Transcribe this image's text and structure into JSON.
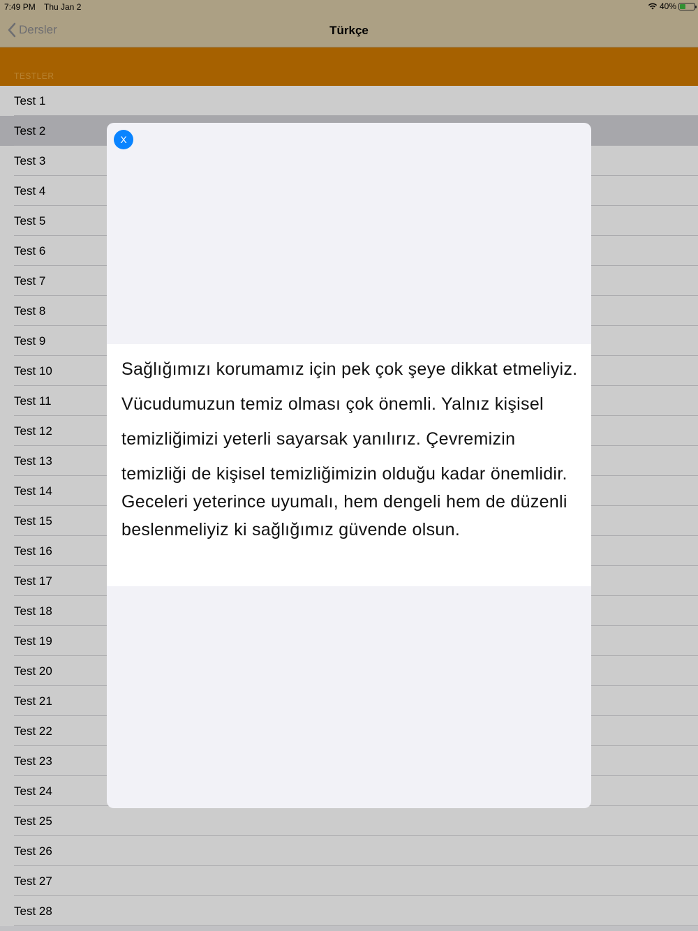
{
  "status": {
    "time": "7:49 PM",
    "date": "Thu Jan 2",
    "battery": "40%",
    "battery_level": 0.4
  },
  "nav": {
    "back_label": "Dersler",
    "title": "Türkçe"
  },
  "section": {
    "header": "TESTLER"
  },
  "tests": [
    "Test 1",
    "Test 2",
    "Test 3",
    "Test 4",
    "Test 5",
    "Test 6",
    "Test 7",
    "Test 8",
    "Test 9",
    "Test 10",
    "Test 11",
    "Test 12",
    "Test 13",
    "Test 14",
    "Test 15",
    "Test 16",
    "Test 17",
    "Test 18",
    "Test 19",
    "Test 20",
    "Test 21",
    "Test 22",
    "Test 23",
    "Test 24",
    "Test 25",
    "Test 26",
    "Test 27",
    "Test 28"
  ],
  "selected_index": 1,
  "modal": {
    "close_label": "X",
    "passage_lines": [
      "Sağlığımızı korumamız için pek çok şeye dikkat etmeliyiz.",
      "Vücudumuzun temiz olması çok önemli.  Yalnız kişisel",
      "temizliğimizi yeterli sayarsak yanılırız. Çevremizin",
      "temizliği de kişisel temizliğimizin olduğu kadar önemlidir.",
      "Geceleri yeterince uyumalı, hem dengeli hem de düzenli",
      "beslenmeliyiz ki sağlığımız güvende olsun."
    ]
  }
}
